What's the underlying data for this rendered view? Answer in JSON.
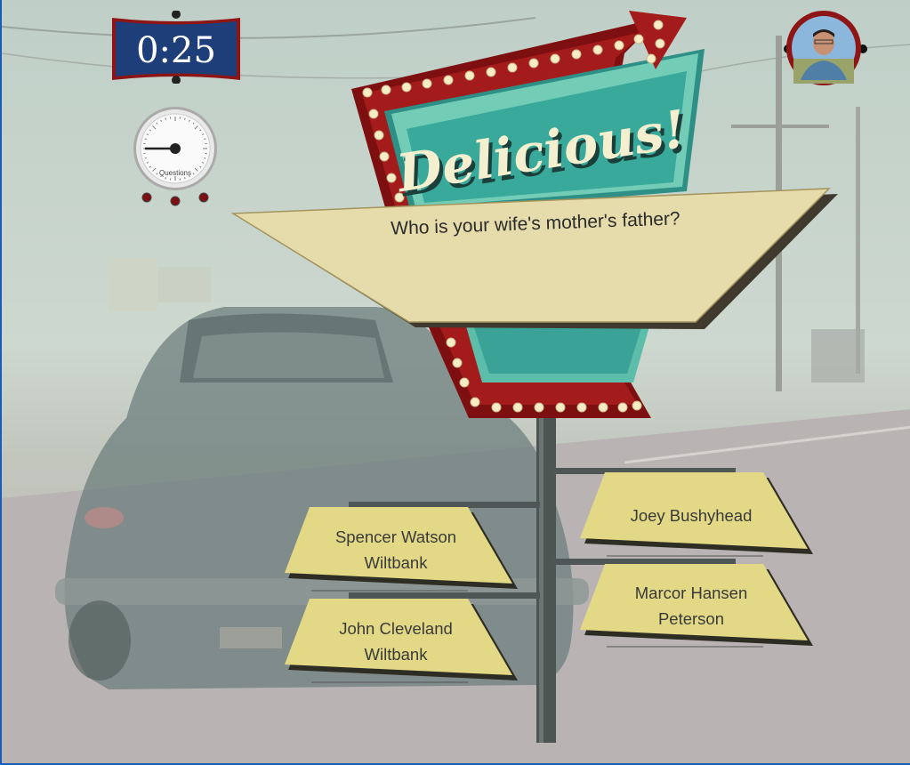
{
  "game": {
    "timer": "0:25",
    "gauge_label": "Questions",
    "sign_title": "Delicious!",
    "question": "Who is your wife's mother's father?",
    "answers": [
      {
        "line1": "Spencer Watson",
        "line2": "Wiltbank"
      },
      {
        "line1": "John Cleveland",
        "line2": "Wiltbank"
      },
      {
        "line1": "Joey Bushyhead",
        "line2": ""
      },
      {
        "line1": "Marcor Hansen",
        "line2": "Peterson"
      }
    ],
    "gauge_value": 0.75
  },
  "colors": {
    "sign_red": "#8e1515",
    "sign_teal": "#37a99c",
    "plank_yellow": "#e4d886",
    "timer_navy": "#1d3e78",
    "bulb": "#f4edc6"
  }
}
